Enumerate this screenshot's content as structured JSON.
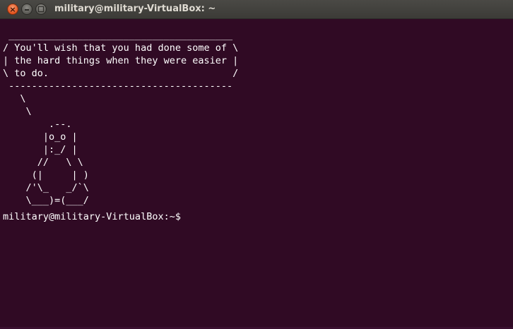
{
  "window": {
    "title": "military@military-VirtualBox: ~",
    "close_glyph": "×"
  },
  "terminal": {
    "output": " _______________________________________\n/ You'll wish that you had done some of \\\n| the hard things when they were easier |\n\\ to do.                                /\n ---------------------------------------\n   \\\n    \\\n        .--.\n       |o_o |\n       |:_/ |\n      //   \\ \\\n     (|     | )\n    /'\\_   _/`\\\n    \\___)=(___/",
    "prompt": "military@military-VirtualBox:~$",
    "input": ""
  },
  "colors": {
    "terminal_background": "#300a24",
    "terminal_text": "#ffffff",
    "titlebar": "#3c3b37",
    "close_button": "#e2531e"
  }
}
